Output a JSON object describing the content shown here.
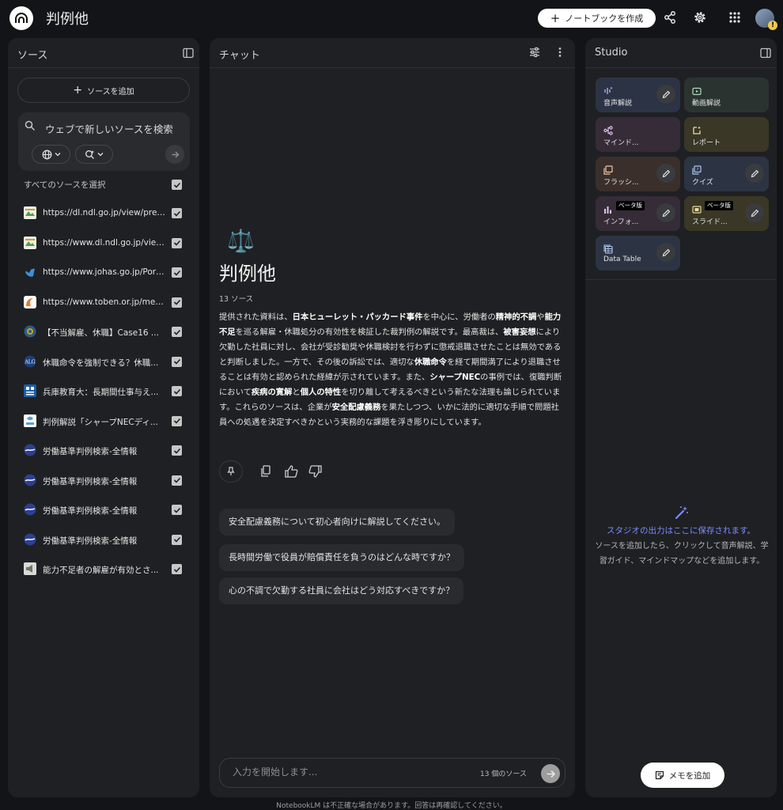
{
  "header": {
    "title": "判例他",
    "create_label": "ノートブックを作成"
  },
  "sources": {
    "title": "ソース",
    "add_label": "ソースを追加",
    "search_placeholder": "ウェブで新しいソースを検索",
    "select_all_label": "すべてのソースを選択",
    "items": [
      {
        "label": "https://dl.ndl.go.jp/view/prepa...",
        "icon": "ndl-icon",
        "color": "#4a9b5f",
        "checked": true
      },
      {
        "label": "https://www.dl.ndl.go.jp/view/...",
        "icon": "ndl-icon",
        "color": "#4a9b5f",
        "checked": true
      },
      {
        "label": "https://www.johas.go.jp/Porta...",
        "icon": "johas-icon",
        "color": "#3b8fd9",
        "checked": true
      },
      {
        "label": "https://www.toben.or.jp/mess...",
        "icon": "toben-icon",
        "color": "#e8791f",
        "checked": true
      },
      {
        "label": "【不当解雇、休職】Case16 ...",
        "icon": "globe-site-icon",
        "color": "#2d5b86",
        "checked": true
      },
      {
        "label": "休職命令を強制できる？休職...",
        "icon": "alg-icon",
        "color": "#1a3f7a",
        "checked": true
      },
      {
        "label": "兵庫教育大：長期間仕事与え...",
        "icon": "newspaper-icon",
        "color": "#1b5ea8",
        "checked": true
      },
      {
        "label": "判例解説「シャープNECディ...",
        "icon": "doc-site-icon",
        "color": "#5aa0c8",
        "checked": true
      },
      {
        "label": "労働基準判例検索-全情報",
        "icon": "zenkiren-icon",
        "color": "#2d3f8f",
        "checked": true
      },
      {
        "label": "労働基準判例検索-全情報",
        "icon": "zenkiren-icon",
        "color": "#2d3f8f",
        "checked": true
      },
      {
        "label": "労働基準判例検索-全情報",
        "icon": "zenkiren-icon",
        "color": "#2d3f8f",
        "checked": true
      },
      {
        "label": "労働基準判例検索-全情報",
        "icon": "zenkiren-icon",
        "color": "#2d3f8f",
        "checked": true
      },
      {
        "label": "能力不足者の解雇が有効とさ...",
        "icon": "megaphone-icon",
        "color": "#d9d9d9",
        "checked": true
      }
    ]
  },
  "chat": {
    "title": "チャット",
    "emoji": "⚖️",
    "notebook_title": "判例他",
    "source_count": "13 ソース",
    "summary_parts": [
      {
        "t": "提供された資料は、",
        "b": false
      },
      {
        "t": "日本ヒューレット・パッカード事件",
        "b": true
      },
      {
        "t": "を中心に、労働者の",
        "b": false
      },
      {
        "t": "精神的不調",
        "b": true
      },
      {
        "t": "や",
        "b": false
      },
      {
        "t": "能力不足",
        "b": true
      },
      {
        "t": "を巡る解雇・休職処分の有効性を検証した裁判例の解説です。最高裁は、",
        "b": false
      },
      {
        "t": "被害妄想",
        "b": true
      },
      {
        "t": "により欠勤した社員に対し、会社が受診勧奨や休職検討を行わずに懲戒退職させたことは無効であると判断しました。一方で、その後の訴訟では、適切な",
        "b": false
      },
      {
        "t": "休職命令",
        "b": true
      },
      {
        "t": "を経て期間満了により退職させることは有効と認められた経緯が示されています。また、",
        "b": false
      },
      {
        "t": "シャープNEC",
        "b": true
      },
      {
        "t": "の事例では、復職判断において",
        "b": false
      },
      {
        "t": "疾病の寛解",
        "b": true
      },
      {
        "t": "と",
        "b": false
      },
      {
        "t": "個人の特性",
        "b": true
      },
      {
        "t": "を切り離して考えるべきという新たな法理も論じられています。これらのソースは、企業が",
        "b": false
      },
      {
        "t": "安全配慮義務",
        "b": true
      },
      {
        "t": "を果たしつつ、いかに法的に適切な手順で問題社員への処遇を決定すべきかという実務的な課題を浮き彫りにしています。",
        "b": false
      }
    ],
    "suggestions": [
      "安全配慮義務について初心者向けに解説してください。",
      "長時間労働で役員が賠償責任を負うのはどんな時ですか？",
      "心の不調で欠勤する社員に会社はどう対応すべきですか？"
    ],
    "input_placeholder": "入力を開始します...",
    "input_source_count": "13 個のソース"
  },
  "studio": {
    "title": "Studio",
    "tiles": [
      {
        "label": "音声解説",
        "icon": "audio-wave-icon",
        "bg": "#2c3344",
        "fg": "#a9bdf4",
        "beta": "",
        "editable": true
      },
      {
        "label": "動画解説",
        "icon": "video-icon",
        "bg": "#2a3330",
        "fg": "#b4d9c2",
        "beta": "",
        "editable": false
      },
      {
        "label": "マインド...",
        "icon": "mindmap-icon",
        "bg": "#352c38",
        "fg": "#e1c2ee",
        "beta": "",
        "editable": false
      },
      {
        "label": "レポート",
        "icon": "report-icon",
        "bg": "#3a3726",
        "fg": "#e8dc9c",
        "beta": "",
        "editable": false
      },
      {
        "label": "フラッシ...",
        "icon": "flashcard-icon",
        "bg": "#3a2f2a",
        "fg": "#f2c7a8",
        "beta": "",
        "editable": true
      },
      {
        "label": "クイズ",
        "icon": "quiz-icon",
        "bg": "#2c3443",
        "fg": "#b0c8ee",
        "beta": "",
        "editable": true
      },
      {
        "label": "インフォ...",
        "icon": "infographic-icon",
        "bg": "#352c38",
        "fg": "#e1c2ee",
        "beta": "ベータ版",
        "editable": true
      },
      {
        "label": "スライド...",
        "icon": "slides-icon",
        "bg": "#3a3726",
        "fg": "#e8dc9c",
        "beta": "ベータ版",
        "editable": true
      },
      {
        "label": "Data Table",
        "icon": "table-icon",
        "bg": "#2c3443",
        "fg": "#b0c8ee",
        "beta": "",
        "editable": true
      }
    ],
    "empty_title": "スタジオの出力はここに保存されます。",
    "empty_desc": "ソースを追加したら、クリックして音声解説、学習ガイド、マインドマップなどを追加します。",
    "memo_label": "メモを追加"
  },
  "footer": "NotebookLM は不正確な場合があります。回答は再確認してください。"
}
